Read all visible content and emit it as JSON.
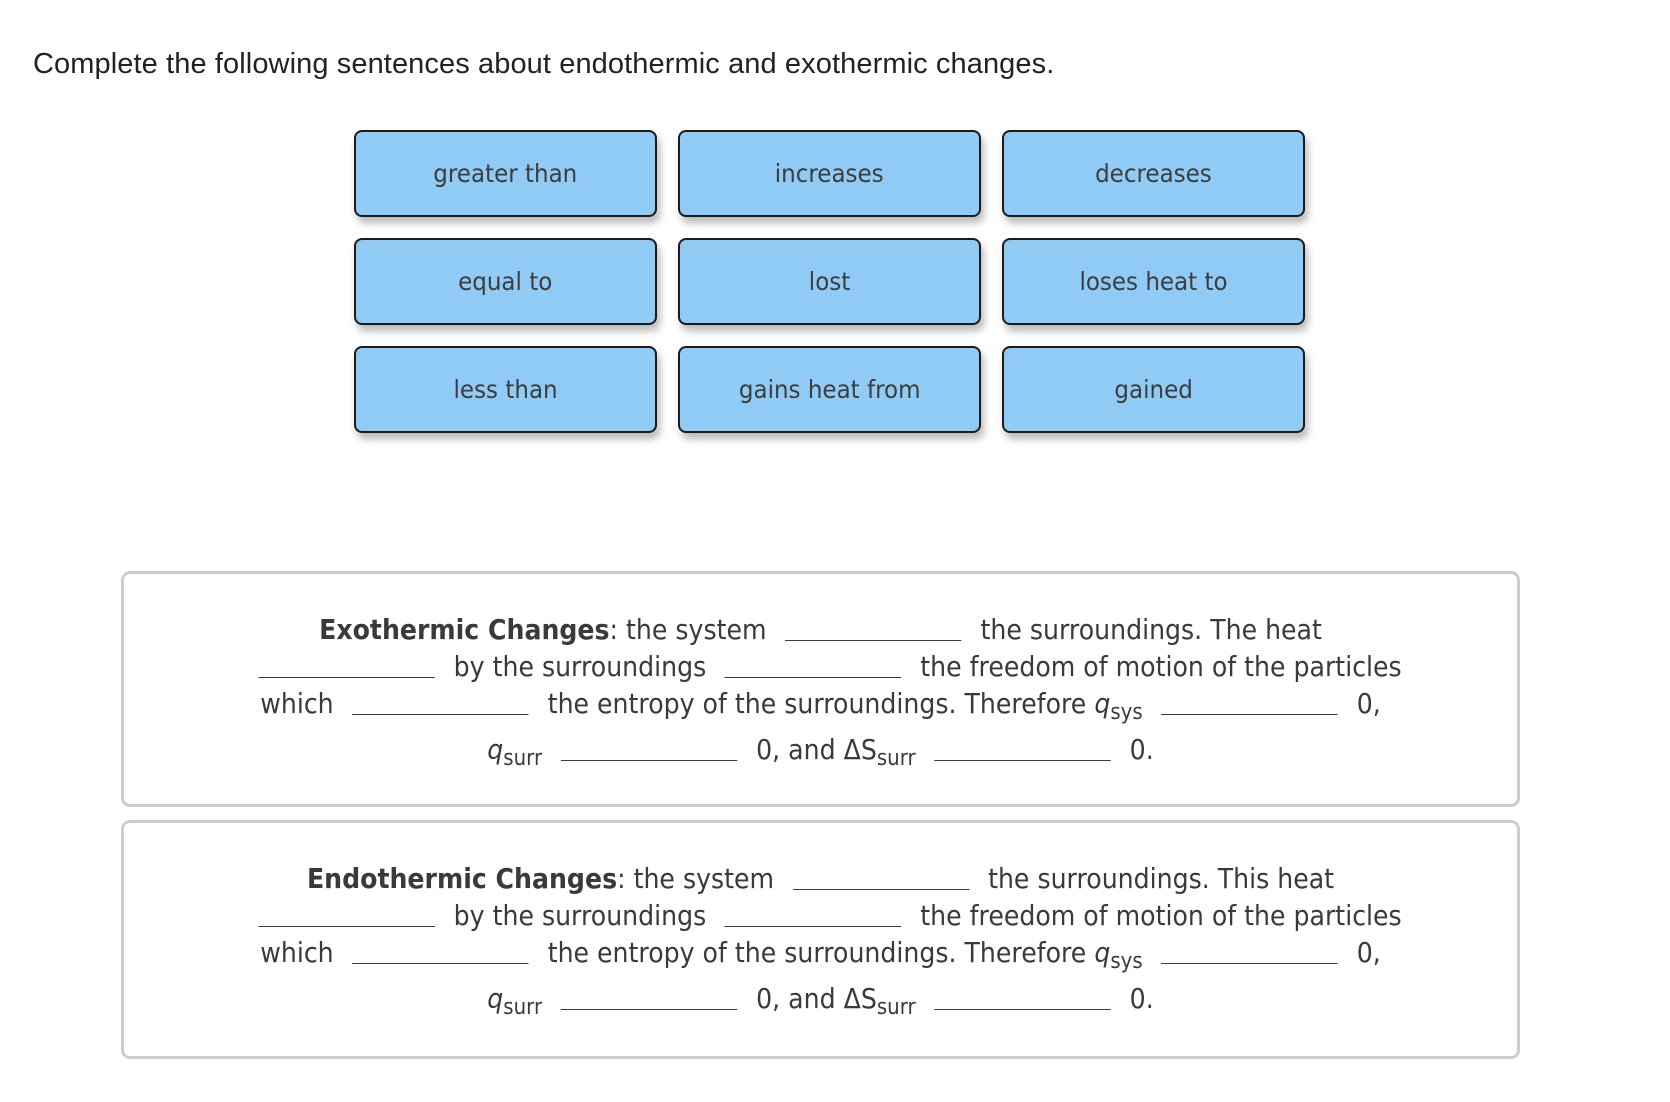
{
  "instructions": "Complete the following sentences about endothermic and exothermic changes.",
  "answer_bank": {
    "tiles": [
      "greater than",
      "increases",
      "decreases",
      "equal to",
      "lost",
      "loses heat to",
      "less than",
      "gains heat from",
      "gained"
    ],
    "tile_color": "#90CBF5",
    "tile_border_color": "#1B1B1B"
  },
  "sentences": {
    "exothermic": {
      "lead": "Exothermic Changes",
      "colon": ":",
      "t1": "the system",
      "t2": "the surroundings. The heat",
      "t3": "by the surroundings",
      "t4": "the freedom of motion of the particles",
      "t5": "which",
      "t6": "the entropy of the surroundings. Therefore",
      "qsys_var": "q",
      "qsys_sub": "sys",
      "t7": "0,",
      "qsurr_var": "q",
      "qsurr_sub": "surr",
      "t8": "0, and ΔS",
      "dssurr_sub": "surr",
      "t9": "0."
    },
    "endothermic": {
      "lead": "Endothermic Changes",
      "colon": ":",
      "t1": "the system",
      "t2": "the surroundings. This heat",
      "t3": "by the surroundings",
      "t4": "the freedom of motion of the particles",
      "t5": "which",
      "t6": "the entropy of the surroundings. Therefore",
      "qsys_var": "q",
      "qsys_sub": "sys",
      "t7": "0,",
      "qsurr_var": "q",
      "qsurr_sub": "surr",
      "t8": "0, and ΔS",
      "dssurr_sub": "surr",
      "t9": "0."
    }
  },
  "box_border_color": "#CDCDCD"
}
